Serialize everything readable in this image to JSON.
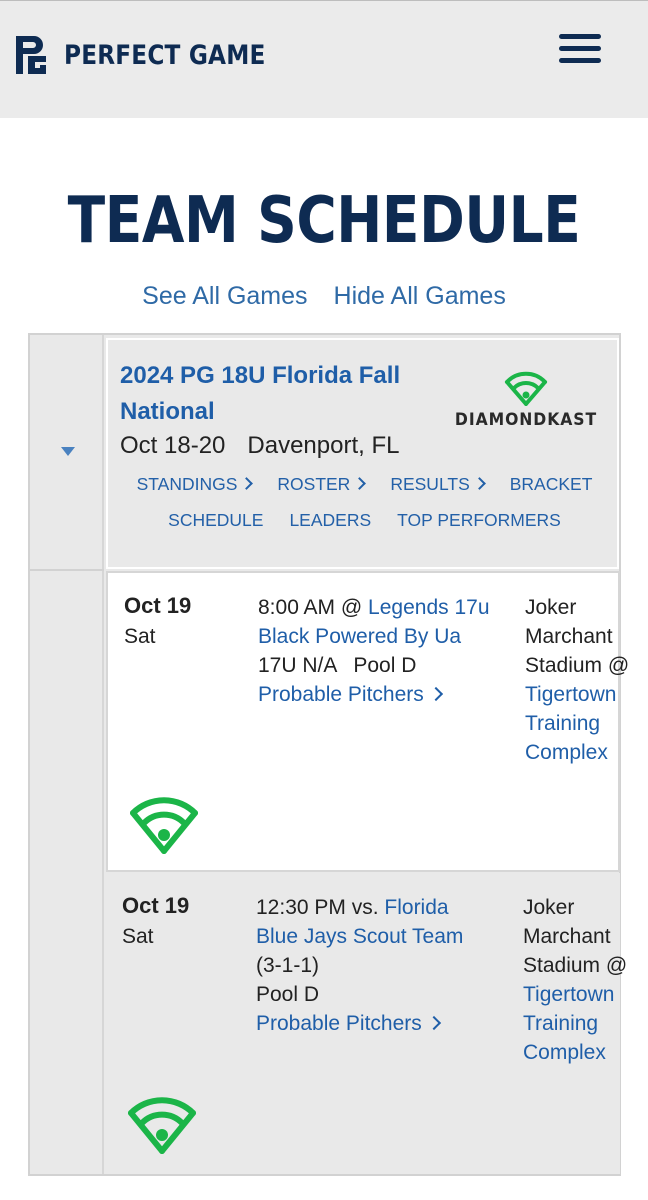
{
  "header": {
    "brand": "PERFECT GAME",
    "colors": {
      "navy": "#0e2b52",
      "link": "#1f5ea8",
      "diamondkast_green": "#1bb548"
    }
  },
  "page": {
    "title": "TEAM SCHEDULE",
    "see_all": "See All Games",
    "hide_all": "Hide All Games"
  },
  "event": {
    "name": "2024 PG 18U Florida Fall National",
    "dates": "Oct 18-20",
    "location": "Davenport, FL",
    "partner_logo_text": "DIAMONDKAST",
    "links_row1": [
      {
        "label": "STANDINGS",
        "chevron": true
      },
      {
        "label": "ROSTER",
        "chevron": true
      },
      {
        "label": "RESULTS",
        "chevron": true
      },
      {
        "label": "BRACKET",
        "chevron": false
      }
    ],
    "links_row2": [
      {
        "label": "SCHEDULE"
      },
      {
        "label": "LEADERS"
      },
      {
        "label": "TOP PERFORMERS"
      }
    ]
  },
  "games": [
    {
      "date": "Oct 19",
      "day": "Sat",
      "time_prefix": "8:00 AM @ ",
      "opponent": "Legends 17u Black Powered By Ua",
      "record": "",
      "division": "17U N/A",
      "pool": "Pool D",
      "pitchers_label": "Probable Pitchers",
      "venue_text": "Joker Marchant Stadium @",
      "venue_link": "Tigertown Training Complex"
    },
    {
      "date": "Oct 19",
      "day": "Sat",
      "time_prefix": "12:30 PM vs. ",
      "opponent": "Florida Blue Jays Scout Team",
      "record": "(3-1-1)",
      "division": "",
      "pool": "Pool D",
      "pitchers_label": "Probable Pitchers",
      "venue_text": "Joker Marchant Stadium @",
      "venue_link": "Tigertown Training Complex"
    }
  ]
}
